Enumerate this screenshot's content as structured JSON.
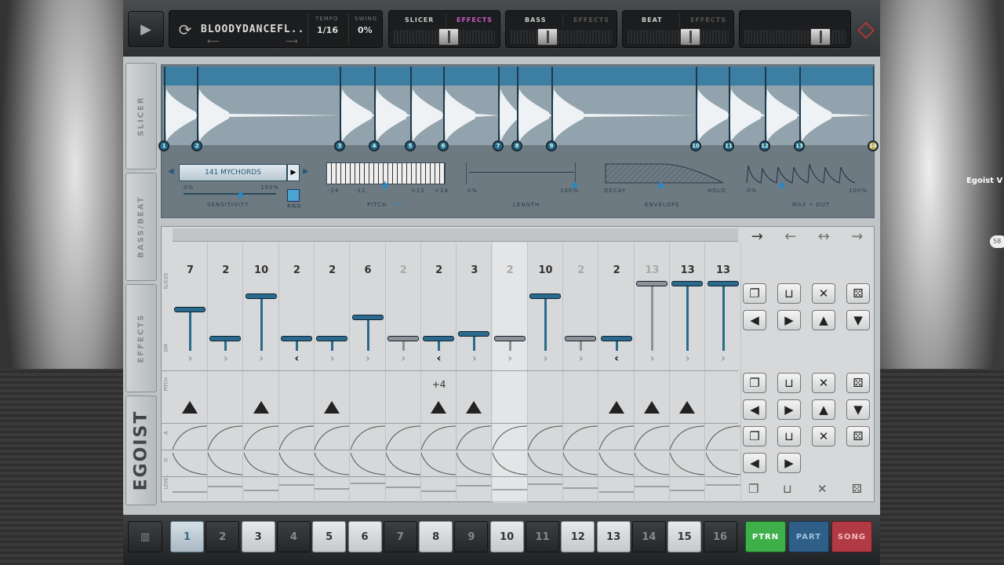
{
  "topbar": {
    "song_name": "BLOODYDANCEFL..",
    "tempo_label": "TEMPO",
    "tempo_value": "1/16",
    "swing_label": "SWING",
    "swing_value": "0%",
    "channels": [
      {
        "name": "SLICER",
        "effects": "EFFECTS",
        "active_effects": true
      },
      {
        "name": "BASS",
        "effects": "EFFECTS",
        "active_effects": false
      },
      {
        "name": "BEAT",
        "effects": "EFFECTS",
        "active_effects": false
      }
    ]
  },
  "side_tabs": [
    "SLICER",
    "BASS/BEAT",
    "EFFECTS",
    "EGOIST"
  ],
  "slicer": {
    "markers": [
      "1",
      "2",
      "3",
      "4",
      "5",
      "6",
      "7",
      "8",
      "9",
      "10",
      "11",
      "12",
      "13",
      "14"
    ],
    "preset": "141 MYCHORDS",
    "sensitivity_min": "0%",
    "sensitivity_max": "100%",
    "sensitivity_label": "SENSITIVITY",
    "rnd_label": "RND",
    "pitch_ticks": [
      "-24",
      "-12",
      "",
      "+12",
      "+24"
    ],
    "pitch_label": "PITCH",
    "pitch_value": "10",
    "length_min": "0%",
    "length_max": "100%",
    "length_label": "LENGTH",
    "decay_label": "DECAY",
    "hold_label": "HOLD",
    "envelope_label": "ENVELOPE",
    "max_min": "0%",
    "max_max": "100%",
    "max_label": "MAX • OUT"
  },
  "pattern": {
    "row_labels": [
      "SLICES",
      "DIR",
      "PITCH",
      "A",
      "D",
      "LEVEL"
    ],
    "steps": [
      {
        "n": "7",
        "on": true,
        "h": 0.6,
        "rev": false
      },
      {
        "n": "2",
        "on": true,
        "h": 0.15,
        "rev": false
      },
      {
        "n": "10",
        "on": true,
        "h": 0.8,
        "rev": false
      },
      {
        "n": "2",
        "on": true,
        "h": 0.15,
        "rev": true
      },
      {
        "n": "2",
        "on": true,
        "h": 0.15,
        "rev": false
      },
      {
        "n": "6",
        "on": true,
        "h": 0.48,
        "rev": false
      },
      {
        "n": "2",
        "on": false,
        "h": 0.15,
        "rev": false
      },
      {
        "n": "2",
        "on": true,
        "h": 0.15,
        "rev": true
      },
      {
        "n": "3",
        "on": true,
        "h": 0.22,
        "rev": false
      },
      {
        "n": "2",
        "on": false,
        "h": 0.15,
        "rev": false
      },
      {
        "n": "10",
        "on": true,
        "h": 0.8,
        "rev": false
      },
      {
        "n": "2",
        "on": false,
        "h": 0.15,
        "rev": false
      },
      {
        "n": "2",
        "on": true,
        "h": 0.15,
        "rev": true
      },
      {
        "n": "13",
        "on": false,
        "h": 1.0,
        "rev": false
      },
      {
        "n": "13",
        "on": true,
        "h": 1.0,
        "rev": false
      },
      {
        "n": "13",
        "on": true,
        "h": 1.0,
        "rev": false
      }
    ],
    "pitch_text": "+4",
    "pitch_marks": [
      0,
      2,
      4,
      7,
      8,
      12,
      13,
      14
    ]
  },
  "bottom": {
    "pads": [
      "1",
      "2",
      "3",
      "4",
      "5",
      "6",
      "7",
      "8",
      "9",
      "10",
      "11",
      "12",
      "13",
      "14",
      "15",
      "16"
    ],
    "pad_lit": [
      0,
      2,
      4,
      5,
      7,
      9,
      11,
      12,
      14
    ],
    "ptrn": "PTRN",
    "part": "PART",
    "song": "SONG"
  },
  "desktop": {
    "window_label": "Egoist V",
    "pill": "58"
  },
  "colors": {
    "accent": "#2a6a8c",
    "ptrn": "#3db04a",
    "part": "#2f5e86",
    "song": "#b13a45"
  }
}
